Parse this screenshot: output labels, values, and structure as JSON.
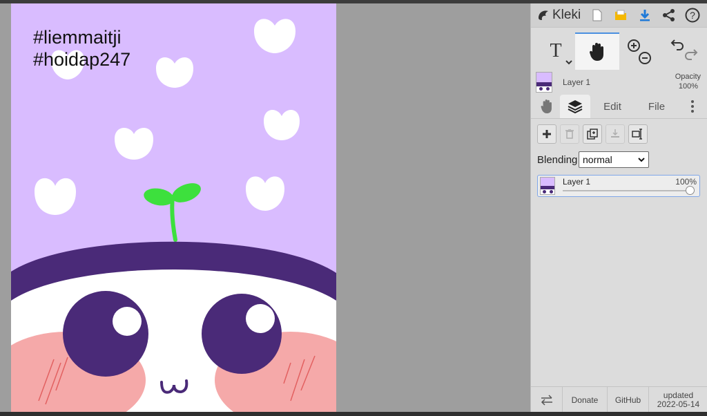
{
  "app": {
    "name": "Kleki"
  },
  "artwork": {
    "line1": "#liemmaitji",
    "line2": "#hoidap247"
  },
  "header": {
    "icons": [
      "new-image-icon",
      "open-folder-icon",
      "download-icon",
      "share-icon",
      "help-icon"
    ]
  },
  "tools": {
    "text_tool_label": "T",
    "active_tool": "hand-tool",
    "zoom_in": "zoom-in-icon",
    "zoom_out": "zoom-out-icon",
    "undo": "undo-icon",
    "redo": "redo-icon"
  },
  "layer_info": {
    "name": "Layer 1",
    "opacity_label": "Opacity",
    "opacity_value": "100%"
  },
  "tabs": {
    "edit": "Edit",
    "file": "File"
  },
  "layers_panel": {
    "blending_label": "Blending",
    "blending_value": "normal",
    "blending_options": [
      "normal"
    ],
    "layers": [
      {
        "name": "Layer 1",
        "opacity": "100%"
      }
    ]
  },
  "footer": {
    "donate": "Donate",
    "github": "GitHub",
    "updated_label": "updated",
    "updated_date": "2022-05-14"
  },
  "colors": {
    "accent": "#4a8fe0",
    "canvas_bg": "#d9bcff",
    "hair": "#4a2a78",
    "cheek": "#f5a9a9",
    "sprout": "#3de03d"
  }
}
